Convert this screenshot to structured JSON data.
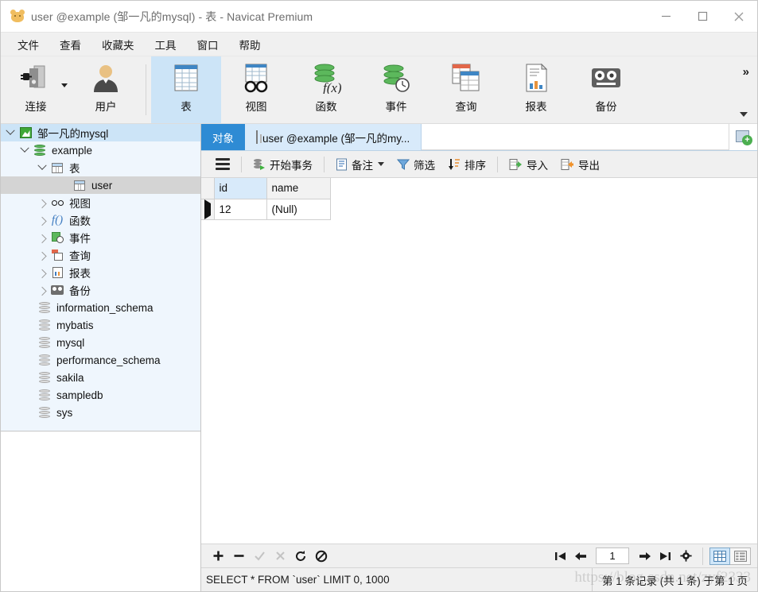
{
  "window": {
    "title": "user @example (邹一凡的mysql) - 表 - Navicat Premium",
    "app_icon": "navicat-logo-icon",
    "minimize_label": "—",
    "maximize_label": "□",
    "close_label": "✕"
  },
  "menubar": {
    "items": [
      {
        "label": "文件"
      },
      {
        "label": "查看"
      },
      {
        "label": "收藏夹"
      },
      {
        "label": "工具"
      },
      {
        "label": "窗口"
      },
      {
        "label": "帮助"
      }
    ]
  },
  "ribbon": {
    "overflow_label": "»",
    "groups": [
      {
        "buttons": [
          {
            "label": "连接",
            "icon": "connection-plug-icon",
            "has_caret": true,
            "active": false
          },
          {
            "label": "用户",
            "icon": "user-person-icon",
            "has_caret": false,
            "active": false
          }
        ]
      },
      {
        "buttons": [
          {
            "label": "表",
            "icon": "table-grid-icon",
            "has_caret": false,
            "active": true
          },
          {
            "label": "视图",
            "icon": "view-glasses-icon",
            "has_caret": false,
            "active": false
          },
          {
            "label": "函数",
            "icon": "function-fx-icon",
            "has_caret": false,
            "active": false
          },
          {
            "label": "事件",
            "icon": "event-clock-icon",
            "has_caret": false,
            "active": false
          },
          {
            "label": "查询",
            "icon": "query-tables-icon",
            "has_caret": false,
            "active": false
          },
          {
            "label": "报表",
            "icon": "report-chart-icon",
            "has_caret": false,
            "active": false
          },
          {
            "label": "备份",
            "icon": "backup-tape-icon",
            "has_caret": false,
            "active": false
          }
        ]
      }
    ]
  },
  "sidebar": {
    "tree": [
      {
        "label": "邹一凡的mysql",
        "icon": "connection-icon",
        "indent": 0,
        "chevron": "down",
        "state": "selected-blue"
      },
      {
        "label": "example",
        "icon": "database-green-icon",
        "indent": 1,
        "chevron": "down",
        "state": "none"
      },
      {
        "label": "表",
        "icon": "table-grid-icon",
        "indent": 2,
        "chevron": "down",
        "state": "none"
      },
      {
        "label": "user",
        "icon": "table-grid-icon",
        "indent": 4,
        "chevron": "none",
        "state": "selected-grey"
      },
      {
        "label": "视图",
        "icon": "view-glasses-icon",
        "indent": 2,
        "chevron": "right",
        "state": "none"
      },
      {
        "label": "函数",
        "icon": "function-fx-icon",
        "indent": 2,
        "chevron": "right",
        "state": "none"
      },
      {
        "label": "事件",
        "icon": "event-clock-icon",
        "indent": 2,
        "chevron": "right",
        "state": "none"
      },
      {
        "label": "查询",
        "icon": "query-tables-icon",
        "indent": 2,
        "chevron": "right",
        "state": "none"
      },
      {
        "label": "报表",
        "icon": "report-chart-icon",
        "indent": 2,
        "chevron": "right",
        "state": "none"
      },
      {
        "label": "备份",
        "icon": "backup-tape-icon",
        "indent": 2,
        "chevron": "right",
        "state": "none"
      },
      {
        "label": "information_schema",
        "icon": "database-grey-icon",
        "indent": 1,
        "chevron": "none",
        "state": "none"
      },
      {
        "label": "mybatis",
        "icon": "database-grey-icon",
        "indent": 1,
        "chevron": "none",
        "state": "none"
      },
      {
        "label": "mysql",
        "icon": "database-grey-icon",
        "indent": 1,
        "chevron": "none",
        "state": "none"
      },
      {
        "label": "performance_schema",
        "icon": "database-grey-icon",
        "indent": 1,
        "chevron": "none",
        "state": "none"
      },
      {
        "label": "sakila",
        "icon": "database-grey-icon",
        "indent": 1,
        "chevron": "none",
        "state": "none"
      },
      {
        "label": "sampledb",
        "icon": "database-grey-icon",
        "indent": 1,
        "chevron": "none",
        "state": "none"
      },
      {
        "label": "sys",
        "icon": "database-grey-icon",
        "indent": 1,
        "chevron": "none",
        "state": "none"
      }
    ]
  },
  "tabs": {
    "items": [
      {
        "label": "对象",
        "style": "primary",
        "icon": "none"
      },
      {
        "label": "user @example (邹一凡的my...",
        "style": "active",
        "icon": "table-grid-icon"
      }
    ],
    "add_tab_label": "+"
  },
  "gridtools": {
    "menu_icon": "hamburger-menu-icon",
    "items": [
      {
        "label": "开始事务",
        "icon": "begin-transaction-icon",
        "caret": false
      },
      {
        "label": "备注",
        "icon": "note-document-icon",
        "caret": true
      },
      {
        "label": "筛选",
        "icon": "filter-funnel-icon",
        "caret": false
      },
      {
        "label": "排序",
        "icon": "sort-arrow-icon",
        "caret": false
      },
      {
        "label": "导入",
        "icon": "import-icon",
        "caret": false
      },
      {
        "label": "导出",
        "icon": "export-icon",
        "caret": false
      }
    ]
  },
  "grid": {
    "columns": [
      {
        "name": "id",
        "highlighted": true
      },
      {
        "name": "name",
        "highlighted": false
      }
    ],
    "rows": [
      {
        "marker": "current-row-marker",
        "id": "12",
        "name": "(Null)",
        "name_is_null": true
      }
    ]
  },
  "rowtools": {
    "buttons": [
      {
        "label": "+",
        "name": "add-record-button",
        "enabled": true
      },
      {
        "label": "−",
        "name": "delete-record-button",
        "enabled": true
      },
      {
        "label": "✓",
        "name": "apply-change-button",
        "enabled": false
      },
      {
        "label": "✕",
        "name": "discard-change-button",
        "enabled": false
      },
      {
        "label": "↻",
        "name": "refresh-button",
        "enabled": true
      },
      {
        "label": "⊘",
        "name": "stop-button",
        "enabled": true
      }
    ]
  },
  "pager": {
    "first_label": "⏮",
    "prev_label": "←",
    "page_value": "1",
    "next_label": "→",
    "last_label": "⏭",
    "settings_label": "⚙",
    "views": [
      {
        "name": "grid-view-toggle",
        "active": true
      },
      {
        "name": "form-view-toggle",
        "active": false
      }
    ]
  },
  "statusbar": {
    "sql": "SELECT * FROM `user` LIMIT 0, 1000",
    "record_info": "第 1 条记录 (共 1 条) 于第 1 页"
  },
  "watermark": {
    "text": "https://blog.csdn.net/zyf2333"
  },
  "colors": {
    "accent_blue": "#2e8bd4",
    "tab_active": "#d8eafa",
    "sidebar_bg": "#eff6fd",
    "selection_blue": "#cce4f7",
    "selection_grey": "#d4d4d4",
    "toolbar_bg": "#f0f0f0",
    "green": "#5cb85c",
    "orange": "#e8933c"
  }
}
